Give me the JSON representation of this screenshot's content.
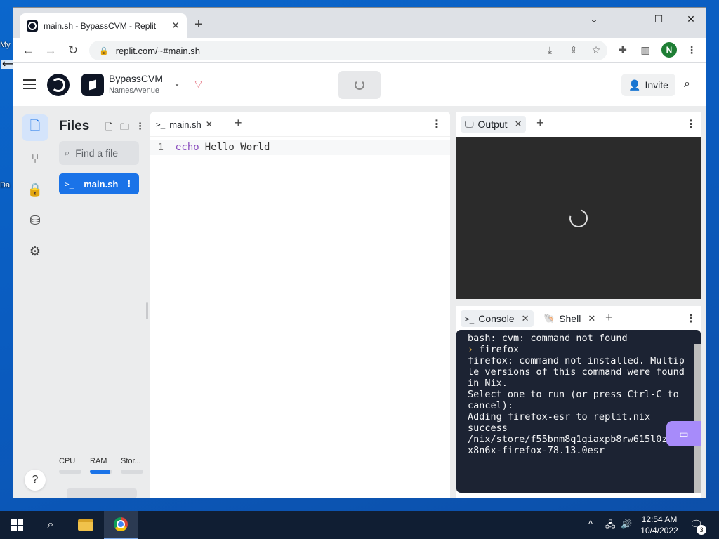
{
  "desktop": {
    "peek_top": "My",
    "peek_bottom": "Da"
  },
  "browser": {
    "tab_title": "main.sh - BypassCVM - Replit",
    "url": "replit.com/~#main.sh",
    "profile_initial": "N"
  },
  "replit": {
    "repl_name": "BypassCVM",
    "owner": "NamesAvenue",
    "invite_label": "Invite",
    "files": {
      "title": "Files",
      "search_placeholder": "Find a file",
      "items": [
        {
          "name": "main.sh",
          "selected": true
        }
      ]
    },
    "resources": [
      {
        "label": "CPU",
        "level": 0
      },
      {
        "label": "RAM",
        "level": 0.9
      },
      {
        "label": "Stor...",
        "level": 0
      }
    ],
    "editor": {
      "tab_label": "main.sh",
      "lines": [
        {
          "number": "1",
          "keyword": "echo",
          "rest": "Hello World"
        }
      ]
    },
    "output": {
      "tab_label": "Output"
    },
    "console": {
      "tab_label": "Console",
      "shell_tab_label": "Shell",
      "lines": [
        "bash: cvm: command not found",
        "firefox",
        "firefox: command not installed. Multiple versions of this command were found in Nix.",
        "Select one to run (or press Ctrl-C to cancel):",
        "Adding firefox-esr to replit.nix",
        "success",
        "/nix/store/f55bnm8q1giaxpb8rw615l0zflcx8n6x-firefox-78.13.0esr"
      ],
      "prompt_symbol": "›"
    }
  },
  "taskbar": {
    "time": "12:54 AM",
    "date": "10/4/2022",
    "notification_count": "3"
  }
}
